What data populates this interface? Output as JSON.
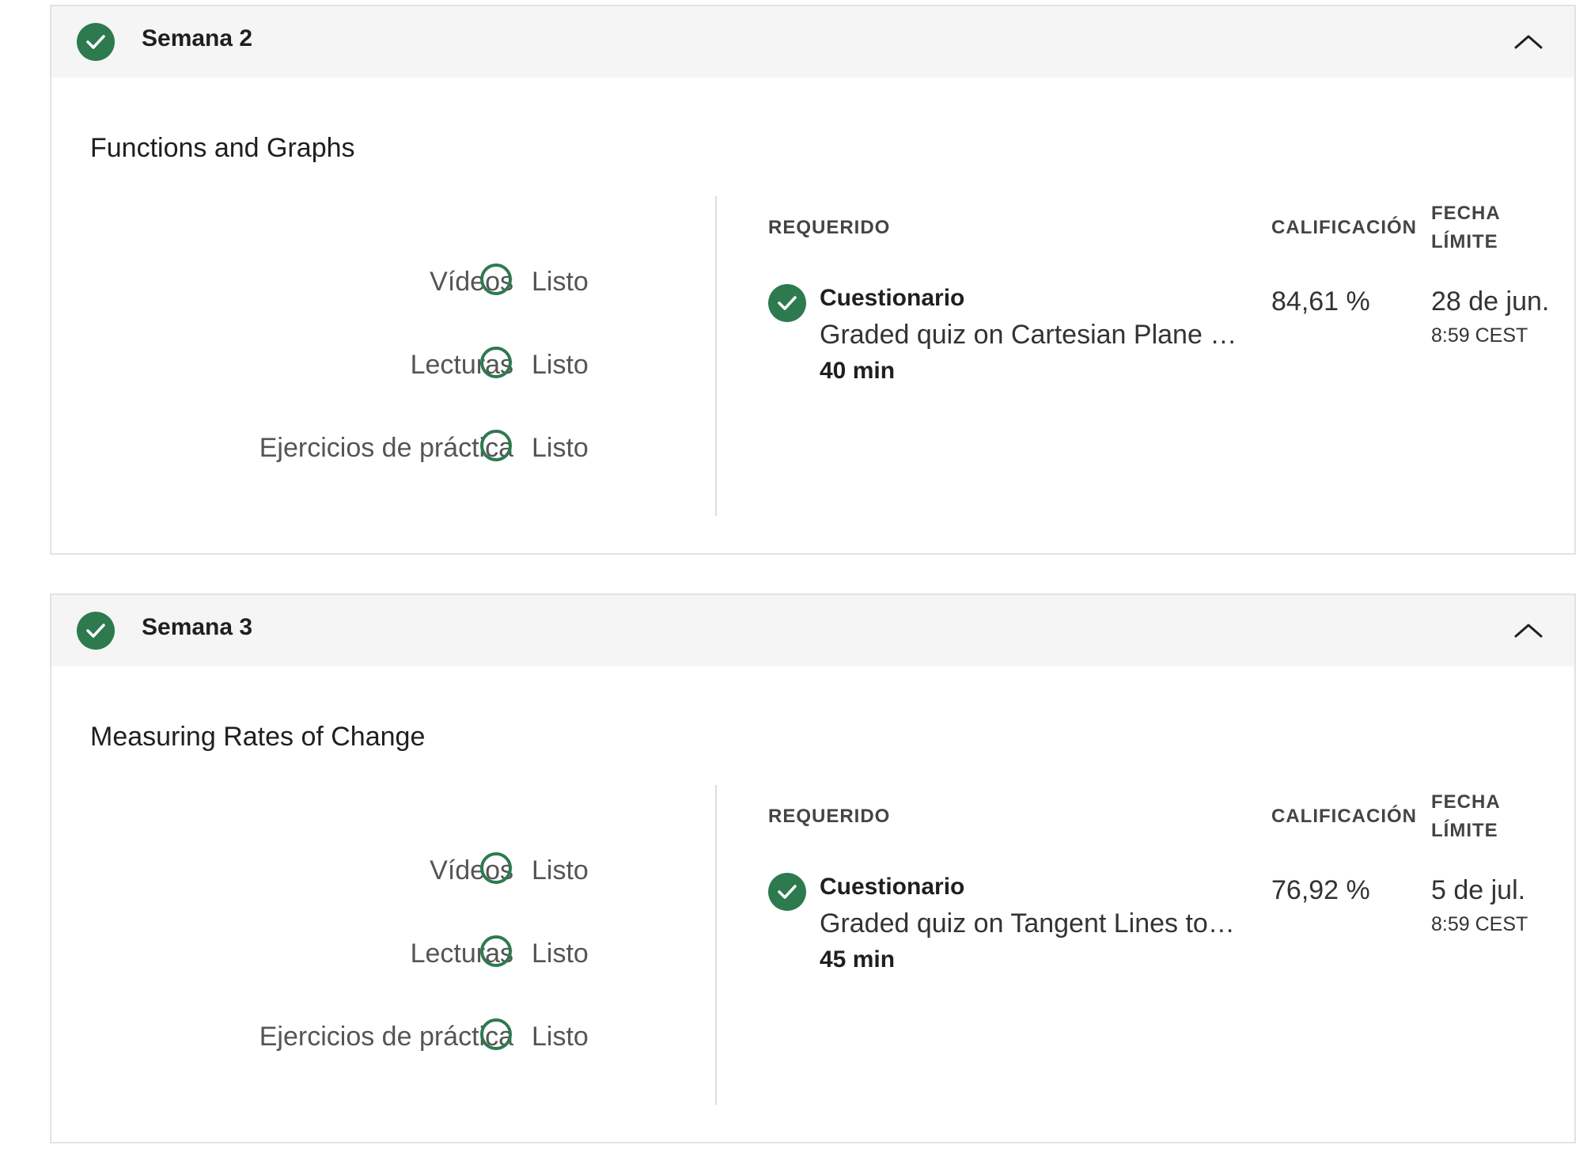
{
  "colors": {
    "accent": "#2d7a4f",
    "header_bg": "#f5f5f5"
  },
  "weeks": [
    {
      "title": "Semana 2",
      "section": "Functions and Graphs",
      "progress": [
        {
          "label": "Vídeos",
          "status": "Listo"
        },
        {
          "label": "Lecturas",
          "status": "Listo"
        },
        {
          "label": "Ejercicios de práctica",
          "status": "Listo"
        }
      ],
      "columns": {
        "required": "REQUERIDO",
        "grade": "CALIFICACIÓN",
        "due_line1": "FECHA",
        "due_line2": "LÍMITE"
      },
      "item": {
        "type": "Cuestionario",
        "title": "Graded quiz on Cartesian Plane and Functions",
        "duration": "40 min",
        "grade": "84,61 %",
        "due_date": "28 de jun.",
        "due_time": "8:59 CEST"
      }
    },
    {
      "title": "Semana 3",
      "section": "Measuring Rates of Change",
      "progress": [
        {
          "label": "Vídeos",
          "status": "Listo"
        },
        {
          "label": "Lecturas",
          "status": "Listo"
        },
        {
          "label": "Ejercicios de práctica",
          "status": "Listo"
        }
      ],
      "columns": {
        "required": "REQUERIDO",
        "grade": "CALIFICACIÓN",
        "due_line1": "FECHA",
        "due_line2": "LÍMITE"
      },
      "item": {
        "type": "Cuestionario",
        "title": "Graded quiz on Tangent Lines to Functions",
        "duration": "45 min",
        "grade": "76,92 %",
        "due_date": "5 de jul.",
        "due_time": "8:59 CEST"
      }
    }
  ]
}
